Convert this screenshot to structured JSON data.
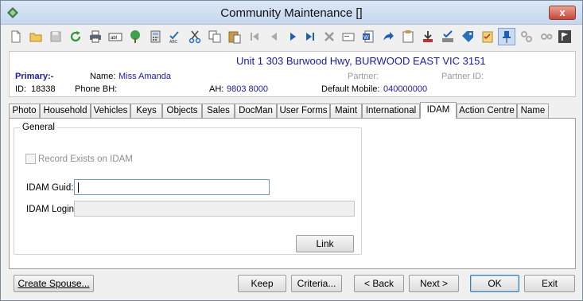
{
  "window": {
    "title": "Community Maintenance  []",
    "close_label": "x"
  },
  "toolbar": {
    "icons": [
      "new-doc-icon",
      "open-folder-icon",
      "save-icon",
      "refresh-icon",
      "print-icon",
      "text-field-icon",
      "tree-icon",
      "calculator-icon",
      "spellcheck-icon",
      "cut-icon",
      "copy-icon",
      "paste-icon",
      "first-record-icon",
      "previous-record-icon",
      "next-record-icon",
      "last-record-icon",
      "delete-icon",
      "card-icon",
      "word-doc-icon",
      "forward-icon",
      "clipboard-icon",
      "download-icon",
      "approve-stamp-icon",
      "tag-icon",
      "checklist-icon",
      "pin-icon",
      "gear-cluster-icon",
      "gears-icon",
      "flag-icon"
    ]
  },
  "info": {
    "address": "Unit 1 303 Burwood Hwy, BURWOOD EAST VIC 3151",
    "primary_label": "Primary:-",
    "name_label": "Name:",
    "name_value": "Miss Amanda",
    "partner_label": "Partner:",
    "partner_id_label": "Partner ID:",
    "id_label": "ID:",
    "id_value": "18338",
    "phone_bh_label": "Phone BH:",
    "ah_label": "AH:",
    "ah_value": "9803 8000",
    "default_mobile_label": "Default Mobile:",
    "default_mobile_value": "040000000"
  },
  "tabs": [
    "Photo",
    "Household",
    "Vehicles",
    "Keys",
    "Objects",
    "Sales",
    "DocMan",
    "User Forms",
    "Maint",
    "International",
    "IDAM",
    "Action Centre",
    "Name"
  ],
  "selected_tab": "IDAM",
  "idam": {
    "group_title": "General",
    "record_exists_label": "Record Exists on IDAM",
    "record_exists_checked": false,
    "guid_label": "IDAM Guid:",
    "guid_value": "",
    "login_label": "IDAM Login:",
    "login_value": "",
    "link_label": "Link"
  },
  "footer": {
    "create_spouse": "Create Spouse...",
    "keep": "Keep",
    "criteria": "Criteria...",
    "back": "< Back",
    "next": "Next >",
    "ok": "OK",
    "exit": "Exit"
  }
}
